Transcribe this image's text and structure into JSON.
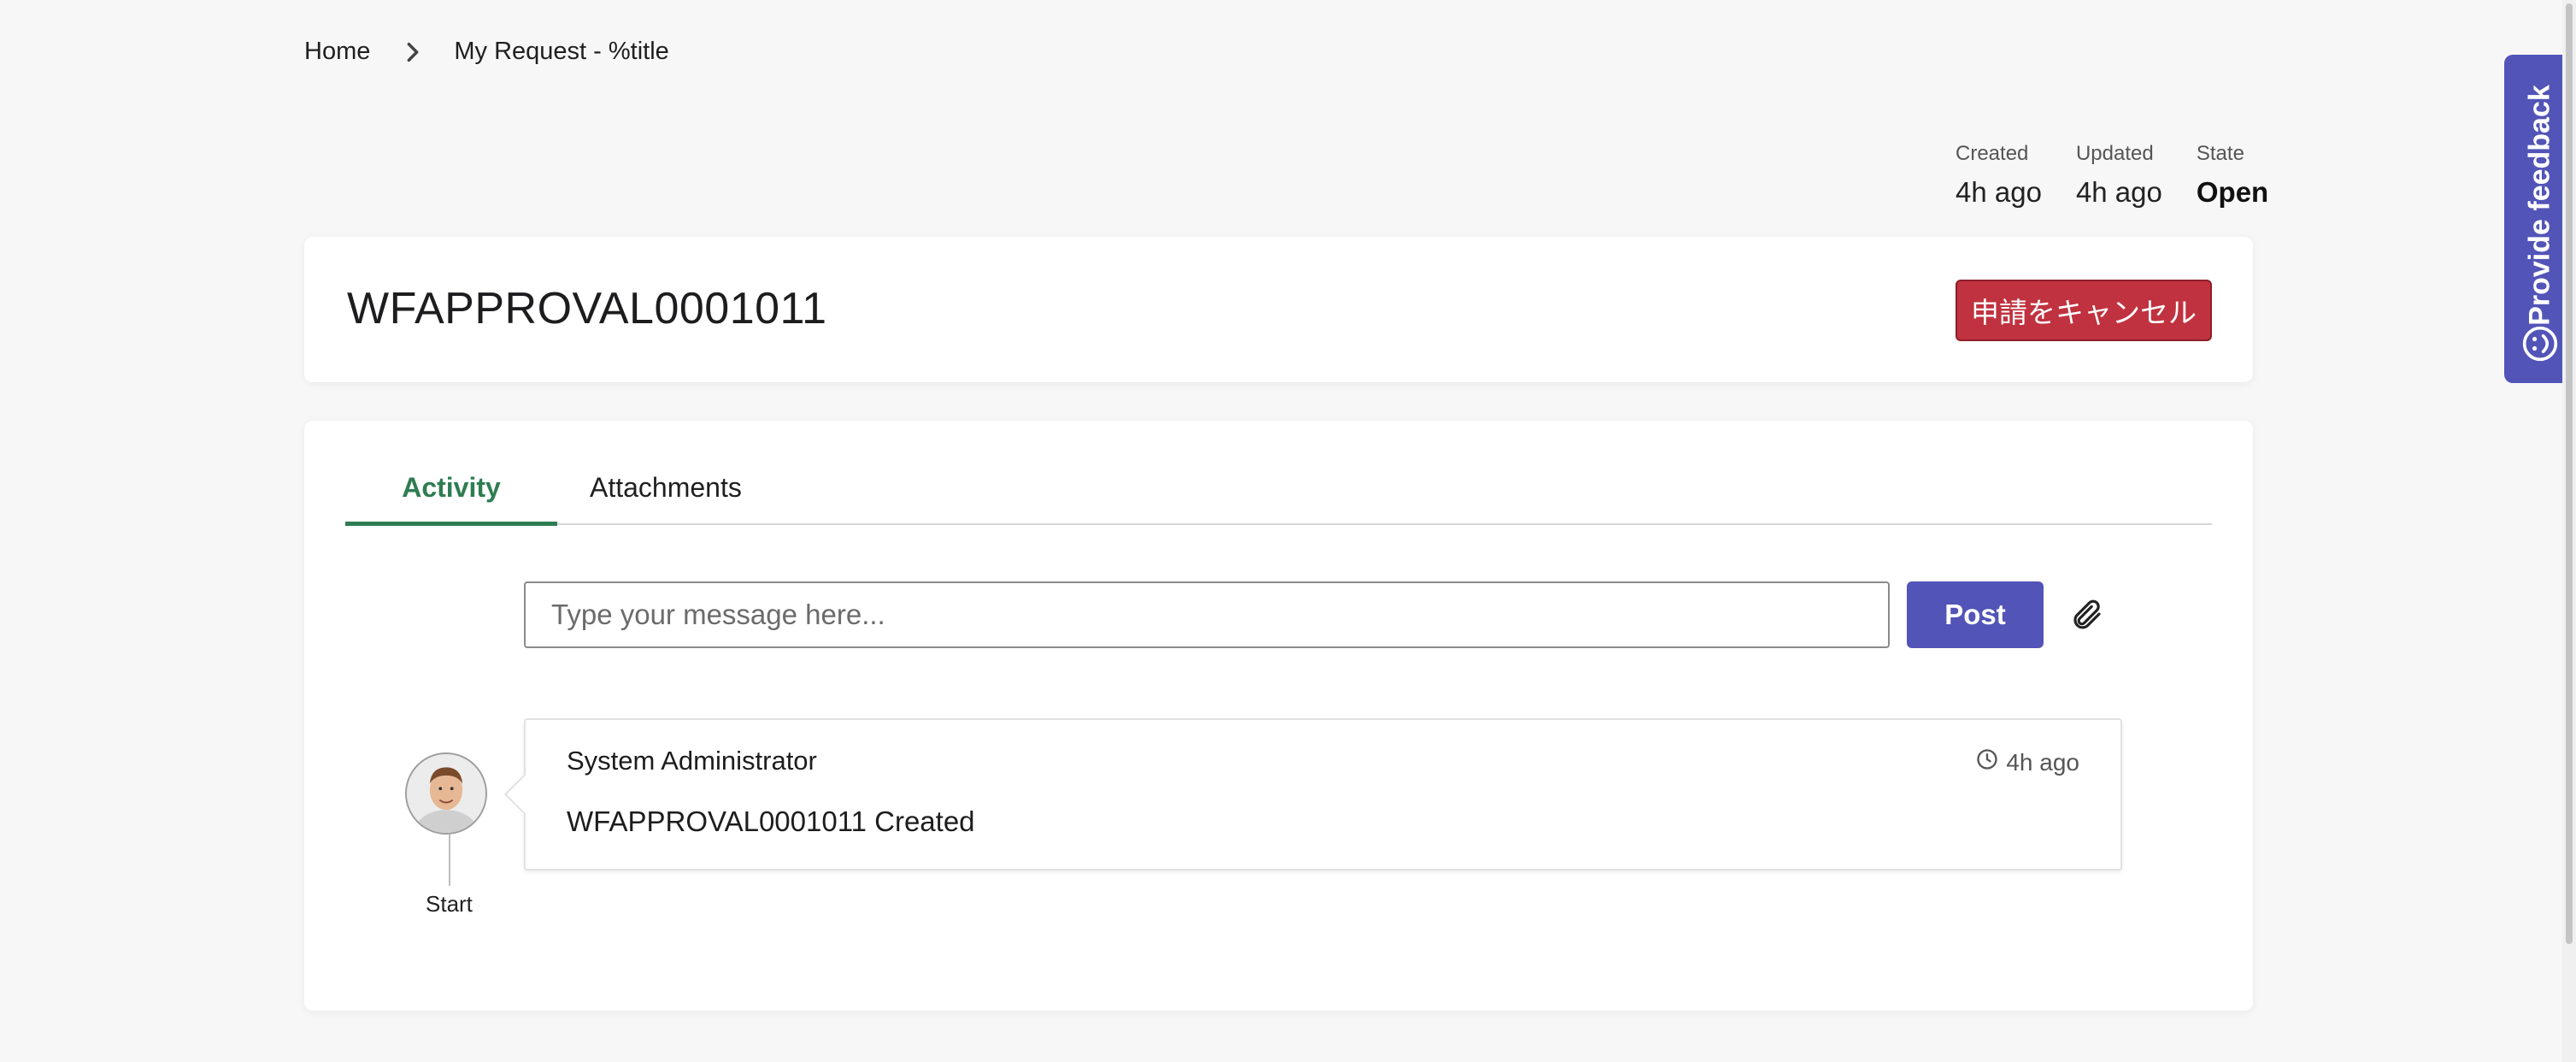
{
  "breadcrumb": {
    "home": "Home",
    "current": "My Request - %title"
  },
  "meta": {
    "created_label": "Created",
    "created_value": "4h ago",
    "updated_label": "Updated",
    "updated_value": "4h ago",
    "state_label": "State",
    "state_value": "Open"
  },
  "header": {
    "title": "WFAPPROVAL0001011",
    "cancel_button": "申請をキャンセル"
  },
  "tabs": [
    {
      "label": "Activity",
      "active": true
    },
    {
      "label": "Attachments",
      "active": false
    }
  ],
  "composer": {
    "placeholder": "Type your message here...",
    "post_button": "Post"
  },
  "activity": {
    "author": "System Administrator",
    "time": "4h ago",
    "message": "WFAPPROVAL0001011 Created",
    "timeline_label": "Start"
  },
  "feedback": {
    "label": "Provide feedback"
  },
  "colors": {
    "accent": "#5254b8",
    "danger": "#c0323f",
    "active_tab": "#2e7d52"
  }
}
